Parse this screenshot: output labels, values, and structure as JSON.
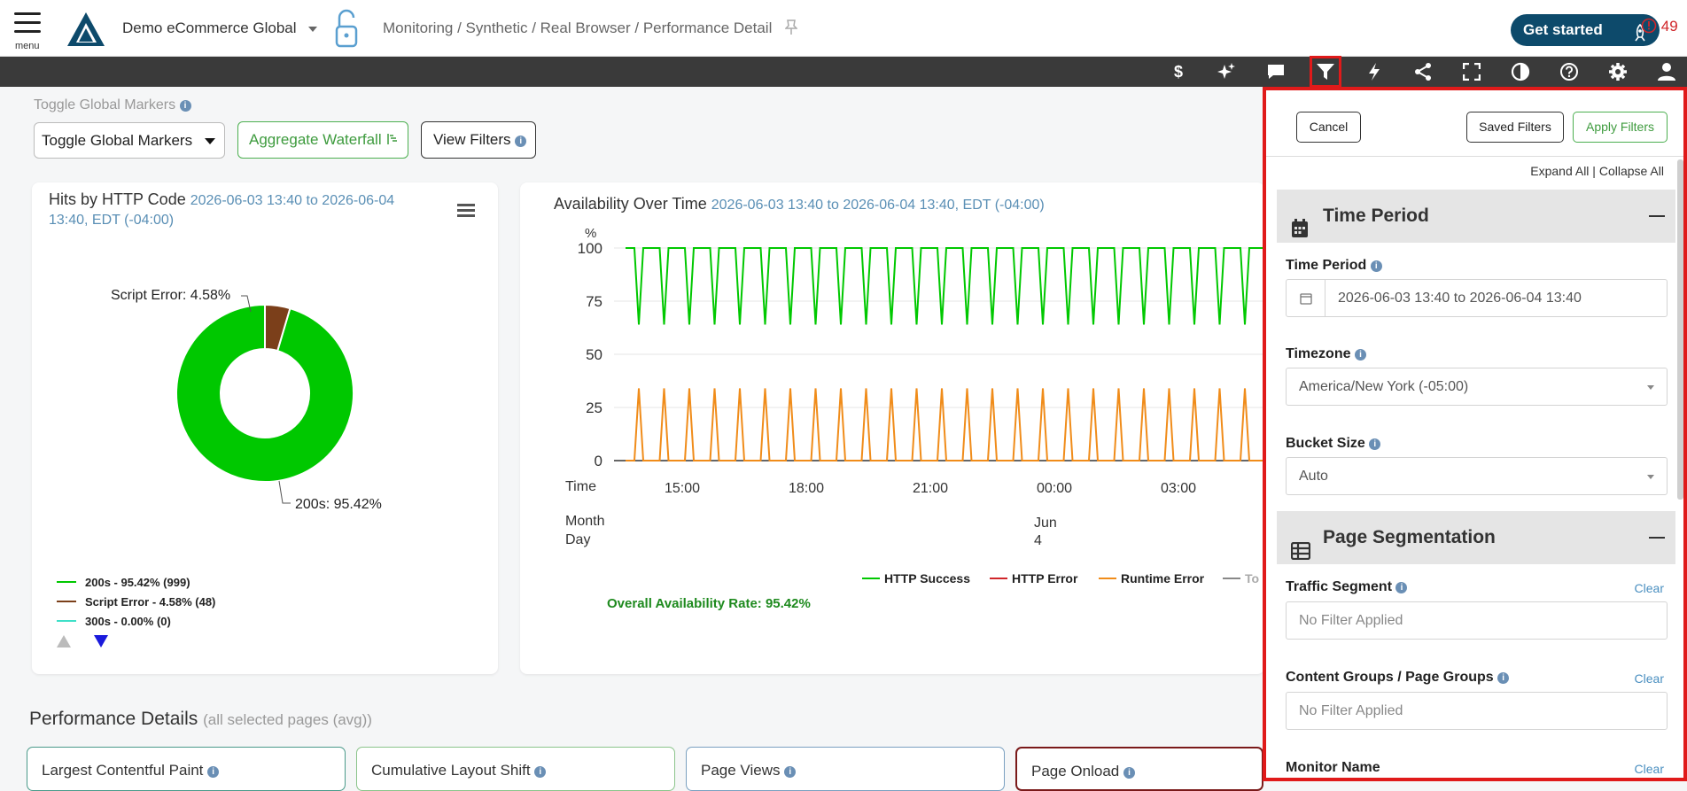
{
  "header": {
    "menu_label": "menu",
    "account": "Demo eCommerce Global",
    "breadcrumb": "Monitoring / Synthetic / Real Browser / Performance Detail",
    "get_started": "Get started",
    "alert_count": "49"
  },
  "iconbar": {
    "icons": [
      "dollar-icon",
      "sparkle-icon",
      "chat-icon",
      "filter-icon",
      "bolt-icon",
      "share-icon",
      "fullscreen-icon",
      "contrast-icon",
      "help-icon",
      "gear-icon",
      "user-icon"
    ],
    "active": "filter-icon"
  },
  "controls": {
    "markers_label": "Toggle Global Markers",
    "markers_select": "Toggle Global Markers",
    "aggregate_waterfall": "Aggregate Waterfall",
    "view_filters": "View Filters"
  },
  "hits_chart": {
    "title": "Hits by HTTP Code",
    "subtitle_line1": "2026-06-03 13:40 to 2026-06-04",
    "subtitle_line2": "13:40, EDT (-04:00)",
    "label_script": "Script Error: 4.58%",
    "label_200": "200s: 95.42%",
    "legend": [
      {
        "label": "200s - 95.42% (999)",
        "color": "#00c800"
      },
      {
        "label": "Script Error - 4.58% (48)",
        "color": "#7b3f1a"
      },
      {
        "label": "300s - 0.00% (0)",
        "color": "#3ee0c8"
      }
    ]
  },
  "availability_chart": {
    "title": "Availability Over Time",
    "subtitle": "2026-06-03 13:40 to 2026-06-04 13:40, EDT (-04:00)",
    "y_unit": "%",
    "y_ticks": [
      "100",
      "75",
      "50",
      "25",
      "0"
    ],
    "x_ticks": [
      "15:00",
      "18:00",
      "21:00",
      "00:00",
      "03:00"
    ],
    "time_label": "Time",
    "month_day_label_1": "Month",
    "month_day_label_2": "Day",
    "month": "Jun",
    "day": "4",
    "legend": [
      {
        "label": "HTTP Success",
        "color": "#00c800"
      },
      {
        "label": "HTTP Error",
        "color": "#d0262a"
      },
      {
        "label": "Runtime Error",
        "color": "#f08c1a"
      },
      {
        "label": "To",
        "color": "#888888"
      }
    ],
    "rate": "Overall Availability Rate: 95.42%"
  },
  "chart_data": [
    {
      "type": "pie",
      "title": "Hits by HTTP Code",
      "categories": [
        "200s",
        "Script Error",
        "300s"
      ],
      "values": [
        95.42,
        4.58,
        0.0
      ],
      "counts": [
        999,
        48,
        0
      ]
    },
    {
      "type": "line",
      "title": "Availability Over Time",
      "ylabel": "%",
      "ylim": [
        0,
        100
      ],
      "x_ticks": [
        "15:00",
        "18:00",
        "21:00",
        "00:00",
        "03:00"
      ],
      "series": [
        {
          "name": "HTTP Success",
          "pattern": "oscillates between 100 and ~65",
          "color": "#00c800"
        },
        {
          "name": "Runtime Error",
          "pattern": "oscillates between 0 and ~35",
          "color": "#f08c1a"
        }
      ],
      "cycles_visible": 30
    }
  ],
  "performance": {
    "title": "Performance Details",
    "subtitle": "(all selected pages (avg))",
    "cards": [
      "Largest Contentful Paint",
      "Cumulative Layout Shift",
      "Page Views",
      "Page Onload"
    ]
  },
  "filter_panel": {
    "cancel": "Cancel",
    "saved_filters": "Saved Filters",
    "apply_filters": "Apply Filters",
    "expand_all": "Expand All",
    "collapse_all": "Collapse All",
    "separator": " | ",
    "time_section": "Time Period",
    "time_period_label": "Time Period",
    "time_period_value": "2026-06-03 13:40 to 2026-06-04 13:40",
    "timezone_label": "Timezone",
    "timezone_value": "America/New York (-05:00)",
    "bucket_label": "Bucket Size",
    "bucket_value": "Auto",
    "page_section": "Page Segmentation",
    "traffic_label": "Traffic Segment",
    "traffic_value": "No Filter Applied",
    "content_label": "Content Groups / Page Groups",
    "content_value": "No Filter Applied",
    "monitor_label": "Monitor Name",
    "clear": "Clear"
  }
}
